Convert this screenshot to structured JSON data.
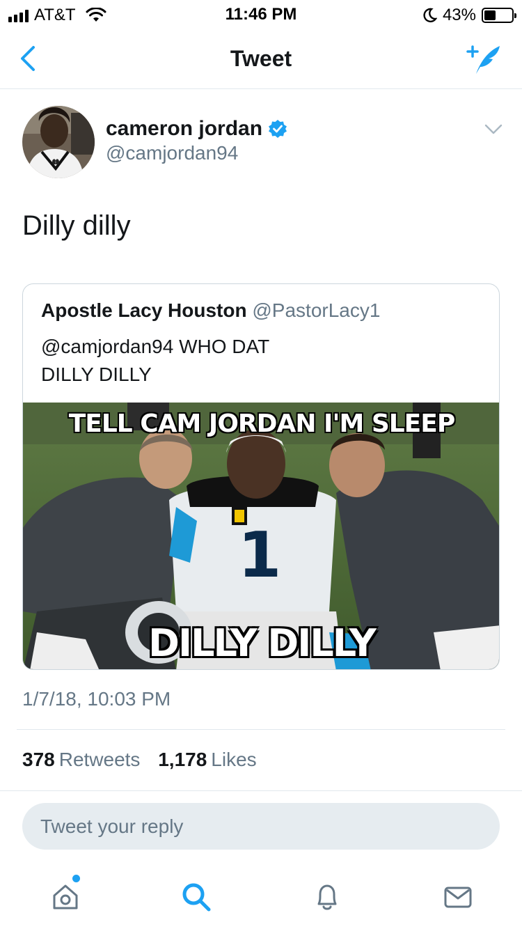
{
  "status_bar": {
    "carrier": "AT&T",
    "time": "11:46 PM",
    "battery_pct": "43%",
    "battery_level": 0.43,
    "icons": [
      "signal-icon",
      "wifi-icon",
      "moon-icon",
      "battery-icon"
    ]
  },
  "nav": {
    "title": "Tweet",
    "back_icon": "chevron-left-icon",
    "compose_icon": "compose-tweet-icon"
  },
  "tweet": {
    "author_name": "cameron jordan",
    "author_handle": "@camjordan94",
    "verified": true,
    "text": "Dilly dilly",
    "timestamp": "1/7/18, 10:03 PM",
    "retweets_count": "378",
    "retweets_label": "Retweets",
    "likes_count": "1,178",
    "likes_label": "Likes"
  },
  "quote": {
    "author_name": "Apostle Lacy Houston",
    "author_handle": "@PastorLacy1",
    "text_line1": "@camjordan94 WHO DAT",
    "text_line2": "DILLY DILLY",
    "image_top_text": "TELL CAM JORDAN I'M SLEEP",
    "image_bottom_text": "DILLY DILLY"
  },
  "reply": {
    "placeholder": "Tweet your reply"
  },
  "tab_bar": {
    "items": [
      "home-icon",
      "search-icon",
      "notifications-icon",
      "messages-icon"
    ]
  },
  "colors": {
    "accent": "#1da1f2",
    "secondary_text": "#657786",
    "divider": "#e1e8ed"
  }
}
